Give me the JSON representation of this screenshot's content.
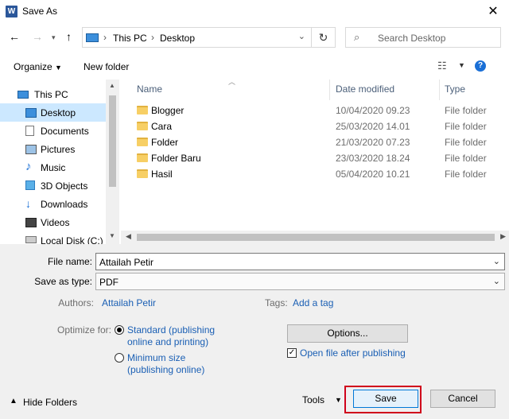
{
  "window": {
    "title": "Save As",
    "app_icon": "W"
  },
  "address": {
    "root": "This PC",
    "current": "Desktop"
  },
  "search": {
    "placeholder": "Search Desktop"
  },
  "toolbar": {
    "organize": "Organize",
    "new_folder": "New folder"
  },
  "nav_pane": {
    "items": [
      {
        "label": "This PC",
        "icon": "pc-icon"
      },
      {
        "label": "Desktop",
        "icon": "desktop-icon",
        "selected": true
      },
      {
        "label": "Documents",
        "icon": "documents-icon"
      },
      {
        "label": "Pictures",
        "icon": "pictures-icon"
      },
      {
        "label": "Music",
        "icon": "music-icon"
      },
      {
        "label": "3D Objects",
        "icon": "3d-objects-icon"
      },
      {
        "label": "Downloads",
        "icon": "downloads-icon"
      },
      {
        "label": "Videos",
        "icon": "videos-icon"
      },
      {
        "label": "Local Disk (C:)",
        "icon": "disk-icon"
      }
    ]
  },
  "file_list": {
    "columns": [
      "Name",
      "Date modified",
      "Type"
    ],
    "rows": [
      {
        "name": "Blogger",
        "date": "10/04/2020 09.23",
        "type": "File folder"
      },
      {
        "name": "Cara",
        "date": "25/03/2020 14.01",
        "type": "File folder"
      },
      {
        "name": "Folder",
        "date": "21/03/2020 07.23",
        "type": "File folder"
      },
      {
        "name": "Folder Baru",
        "date": "23/03/2020 18.24",
        "type": "File folder"
      },
      {
        "name": "Hasil",
        "date": "05/04/2020 10.21",
        "type": "File folder"
      }
    ]
  },
  "form": {
    "file_name_label": "File name:",
    "file_name_value": "Attailah Petir",
    "save_type_label": "Save as type:",
    "save_type_value": "PDF",
    "authors_label": "Authors:",
    "authors_value": "Attailah Petir",
    "tags_label": "Tags:",
    "tags_value": "Add a tag",
    "optimize_label": "Optimize for:",
    "opt_standard_line1": "Standard (publishing",
    "opt_standard_line2": "online and printing)",
    "opt_minimum_line1": "Minimum size",
    "opt_minimum_line2": "(publishing online)",
    "options_button": "Options...",
    "open_after_label": "Open file after publishing",
    "open_after_checked": true
  },
  "footer": {
    "hide_folders": "Hide Folders",
    "tools": "Tools",
    "save": "Save",
    "cancel": "Cancel"
  },
  "colors": {
    "accent": "#0078d7",
    "highlight": "#d0021b",
    "selection": "#cce8ff"
  }
}
